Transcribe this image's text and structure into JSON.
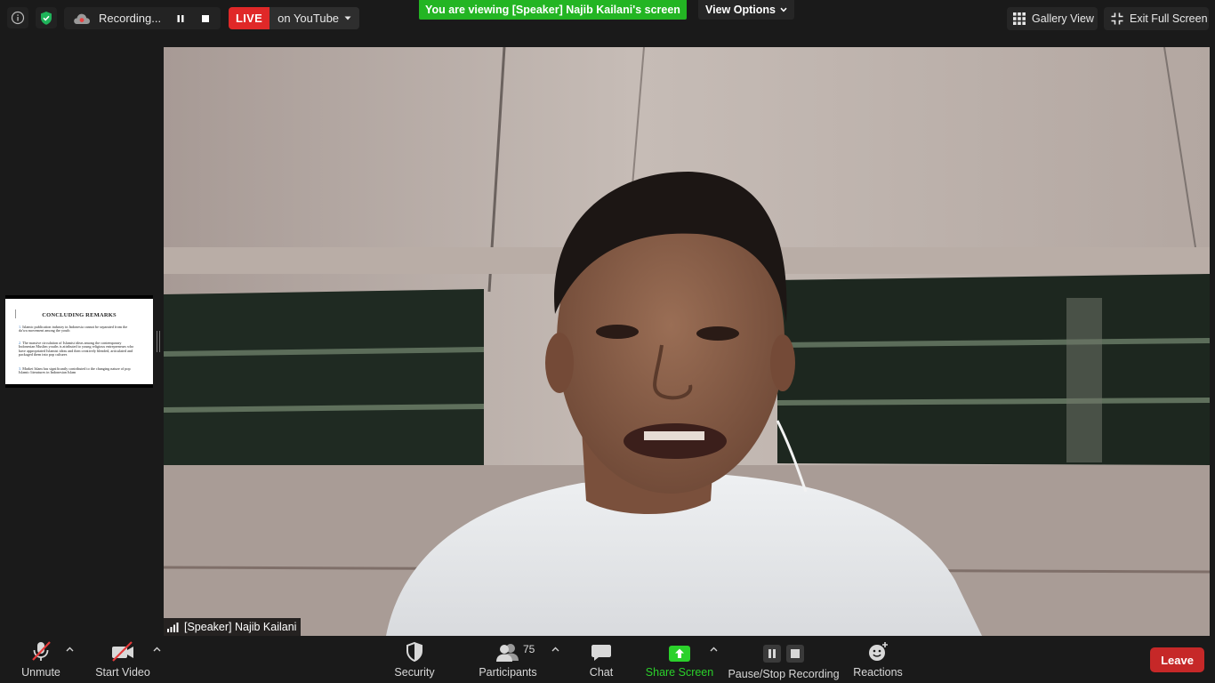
{
  "top_bar": {
    "recording_label": "Recording...",
    "live_badge": "LIVE",
    "live_platform": "on YouTube",
    "viewing_banner": "You are viewing [Speaker] Najib Kailani's screen",
    "view_options_label": "View Options",
    "gallery_view_label": "Gallery View",
    "exit_full_screen_label": "Exit Full Screen"
  },
  "thumbnail_slide": {
    "title": "CONCLUDING REMARKS",
    "points": [
      {
        "num": "1.",
        "text": "Islamic publication industry in Indonesia cannot be separated from the da'wa movement among the youth"
      },
      {
        "num": "2.",
        "text": "The massive circulation of Islamist ideas among the contemporary Indonesian Muslim youths is attributed to young religious entrepreneurs who have appropriated Islamist ideas and then creatively blended, articulated and packaged them into pop cultures"
      },
      {
        "num": "3.",
        "text": "Market Islam has significantly contributed to the changing nature of pop Islamic literatures in Indonesian Islam"
      }
    ]
  },
  "video": {
    "participant_name": "[Speaker] Najib Kailani"
  },
  "toolbar": {
    "unmute_label": "Unmute",
    "start_video_label": "Start Video",
    "security_label": "Security",
    "participants_label": "Participants",
    "participants_count": "75",
    "chat_label": "Chat",
    "share_screen_label": "Share Screen",
    "pause_stop_label": "Pause/Stop Recording",
    "reactions_label": "Reactions",
    "leave_label": "Leave"
  },
  "colors": {
    "live_red": "#e02828",
    "banner_green": "#23b523",
    "share_green": "#2bd12b",
    "leave_red": "#c62828",
    "security_shield_green": "#1fb35a"
  }
}
